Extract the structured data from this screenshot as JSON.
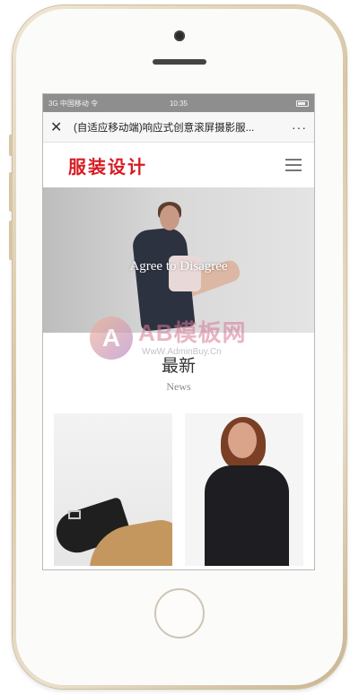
{
  "status_bar": {
    "carrier": "3G 中国移动 令",
    "time": "10:35"
  },
  "browser": {
    "close_symbol": "✕",
    "page_title": "(自适应移动端)响应式创意滚屏摄影服...",
    "more_symbol": "···"
  },
  "site": {
    "logo_text": "服装设计",
    "hero_caption": "Agree to Disagree",
    "section": {
      "title_cn": "最新",
      "title_en": "News"
    }
  },
  "watermark": {
    "circle_letter": "A",
    "main": "AB模板网",
    "sub": "WwW.AdminBuy.Cn"
  },
  "colors": {
    "logo": "#d61c24",
    "status_bar": "#8e8e8e",
    "phone_frame": "#d9c7a6"
  },
  "icons": [
    "close-icon",
    "more-icon",
    "menu-icon",
    "camera-icon",
    "home-button-icon"
  ]
}
